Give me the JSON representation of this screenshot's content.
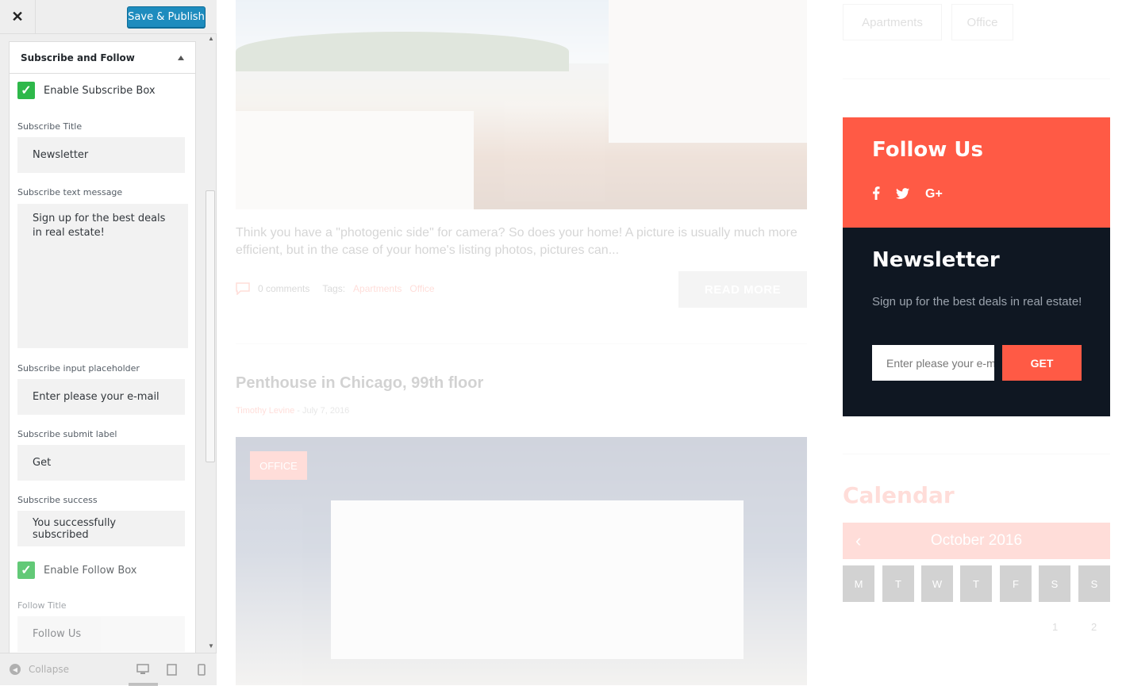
{
  "customizer": {
    "save_publish": "Save & Publish",
    "section_title": "Subscribe and Follow",
    "enable_subscribe": "Enable Subscribe Box",
    "subscribe_title_label": "Subscribe Title",
    "subscribe_title_value": "Newsletter",
    "subscribe_text_label": "Subscribe text message",
    "subscribe_text_value": "Sign up for the best deals in real estate!",
    "subscribe_placeholder_label": "Subscribe input placeholder",
    "subscribe_placeholder_value": "Enter please your e-mail",
    "subscribe_submit_label": "Subscribe submit label",
    "subscribe_submit_value": "Get",
    "subscribe_success_label": "Subscribe success",
    "subscribe_success_value": "You successfully subscribed",
    "enable_follow": "Enable Follow Box",
    "follow_title_label": "Follow Title",
    "follow_title_value": "Follow Us",
    "collapse": "Collapse",
    "accent": "#1e8cbe",
    "check_color": "#2eb84a"
  },
  "preview": {
    "post1": {
      "excerpt": "Think you have a \"photogenic side\" for camera? So does your home! A picture is usually much more efficient, but in the case of your home's listing photos, pictures can...",
      "comments": "0 comments",
      "tags_label": "Tags:",
      "tag1": "Apartments",
      "tag2": "Office",
      "read_more": "READ MORE"
    },
    "post2": {
      "title": "Penthouse in Chicago, 99th floor",
      "author": "Timothy Levine",
      "separator": "-",
      "date": "July 7, 2016",
      "badge": "OFFICE"
    },
    "sidebar": {
      "tag_buttons": [
        "Apartments",
        "Office"
      ],
      "follow_title": "Follow Us",
      "social_icons": [
        "facebook-icon",
        "twitter-icon",
        "google-plus-icon"
      ],
      "newsletter_title": "Newsletter",
      "newsletter_text": "Sign up for the best deals in real estate!",
      "newsletter_placeholder": "Enter please your e-mail",
      "newsletter_button": "GET",
      "calendar_title": "Calendar",
      "calendar_month": "October 2016",
      "calendar_days": [
        "M",
        "T",
        "W",
        "T",
        "F",
        "S",
        "S"
      ],
      "calendar_first_row": [
        "1",
        "2"
      ]
    },
    "brand_color": "#ff5a45",
    "dark_color": "#0f1722"
  }
}
